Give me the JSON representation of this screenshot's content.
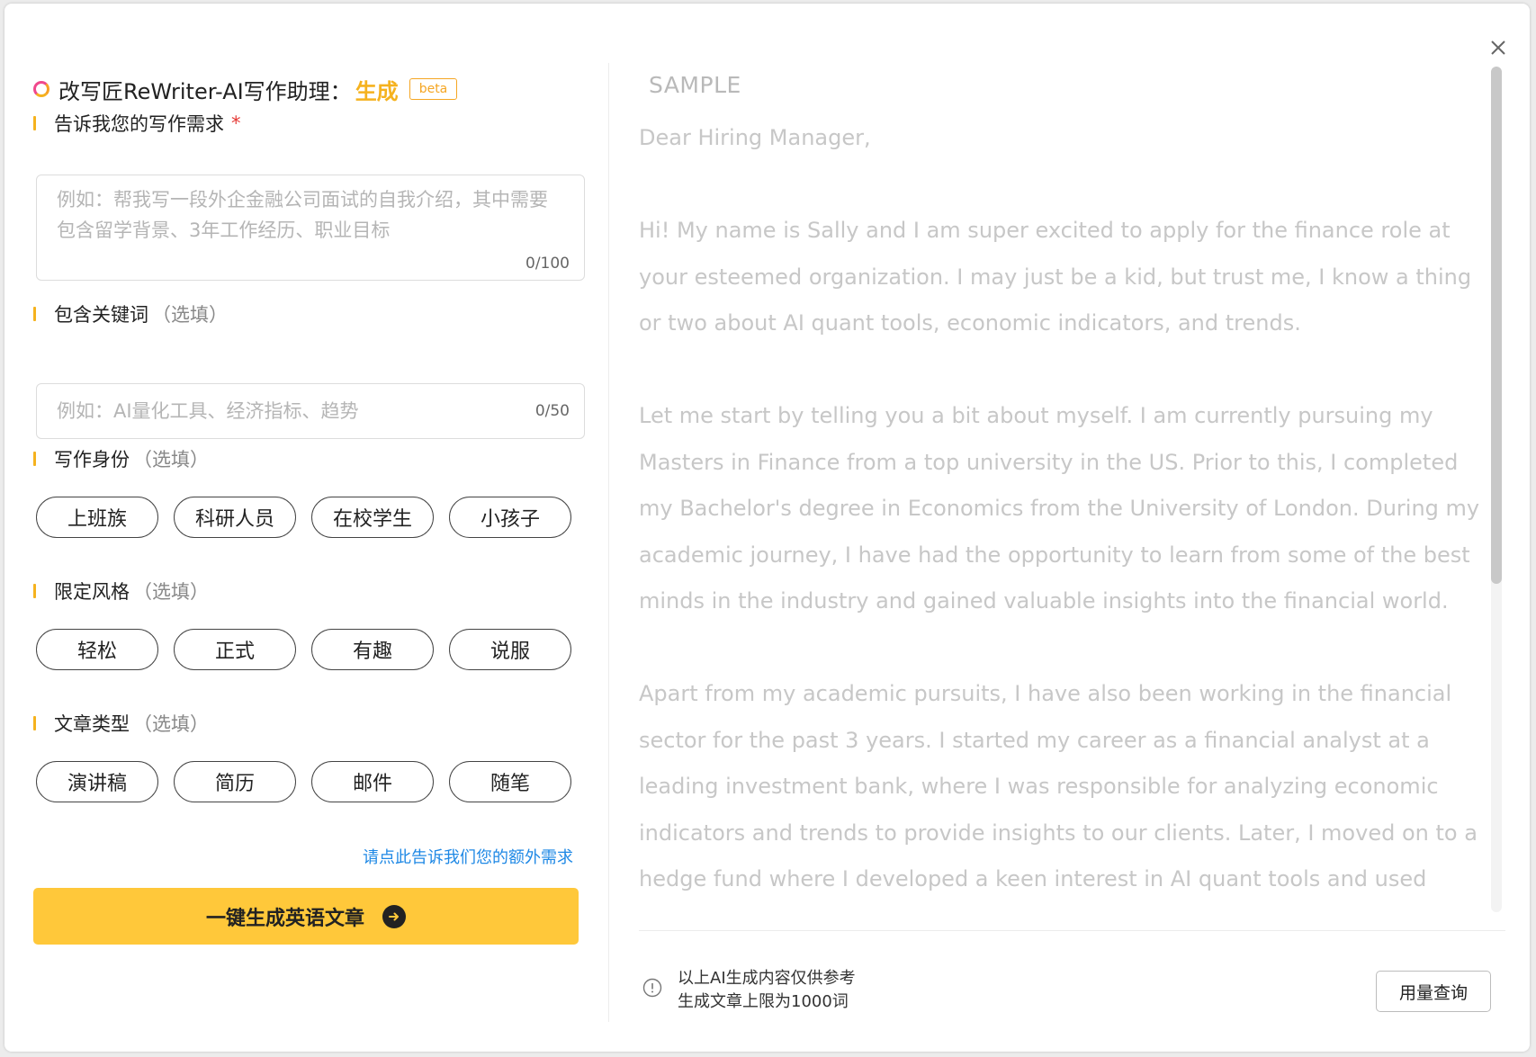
{
  "header": {
    "title": "改写匠ReWriter-AI写作助理：",
    "mode": "生成",
    "badge": "beta",
    "close_icon": "close-icon"
  },
  "requirement": {
    "label": "告诉我您的写作需求",
    "required_mark": "*",
    "placeholder": "例如：帮我写一段外企金融公司面试的自我介绍，其中需要包含留学背景、3年工作经历、职业目标",
    "counter": "0/100"
  },
  "keywords": {
    "label": "包含关键词",
    "optional": "（选填）",
    "placeholder": "例如：AI量化工具、经济指标、趋势",
    "counter": "0/50"
  },
  "identity": {
    "label": "写作身份",
    "optional": "（选填）",
    "options": [
      "上班族",
      "科研人员",
      "在校学生",
      "小孩子"
    ]
  },
  "style": {
    "label": "限定风格",
    "optional": "（选填）",
    "options": [
      "轻松",
      "正式",
      "有趣",
      "说服"
    ]
  },
  "article_type": {
    "label": "文章类型",
    "optional": "（选填）",
    "options": [
      "演讲稿",
      "简历",
      "邮件",
      "随笔"
    ]
  },
  "extra_link": "请点此告诉我们您的额外需求",
  "generate_button": "一键生成英语文章",
  "sample": {
    "tag": "SAMPLE",
    "greeting": "Dear Hiring Manager,",
    "paragraphs": [
      "Hi! My name is Sally and I am super excited to apply for the finance role at your esteemed organization. I may just be a kid, but trust me, I know a thing or two about AI quant tools, economic indicators, and trends.",
      "Let me start by telling you a bit about myself. I am currently pursuing my Masters in Finance from a top university in the US. Prior to this, I completed my Bachelor's degree in Economics from the University of London. During my academic journey, I have had the opportunity to learn from some of the best minds in the industry and gained valuable insights into the financial world.",
      "Apart from my academic pursuits, I have also been working in the financial sector for the past 3 years. I started my career as a financial analyst at a leading investment bank, where I was responsible for analyzing economic indicators and trends to provide insights to our clients. Later, I moved on to a hedge fund where I developed a keen interest in AI quant tools and used them"
    ]
  },
  "footer": {
    "note_line1": "以上AI生成内容仅供参考",
    "note_line2": "生成文章上限为1000词",
    "usage_button": "用量查询"
  },
  "colors": {
    "accent": "#ffc83a",
    "link": "#1e88e5",
    "required": "#e53935"
  }
}
